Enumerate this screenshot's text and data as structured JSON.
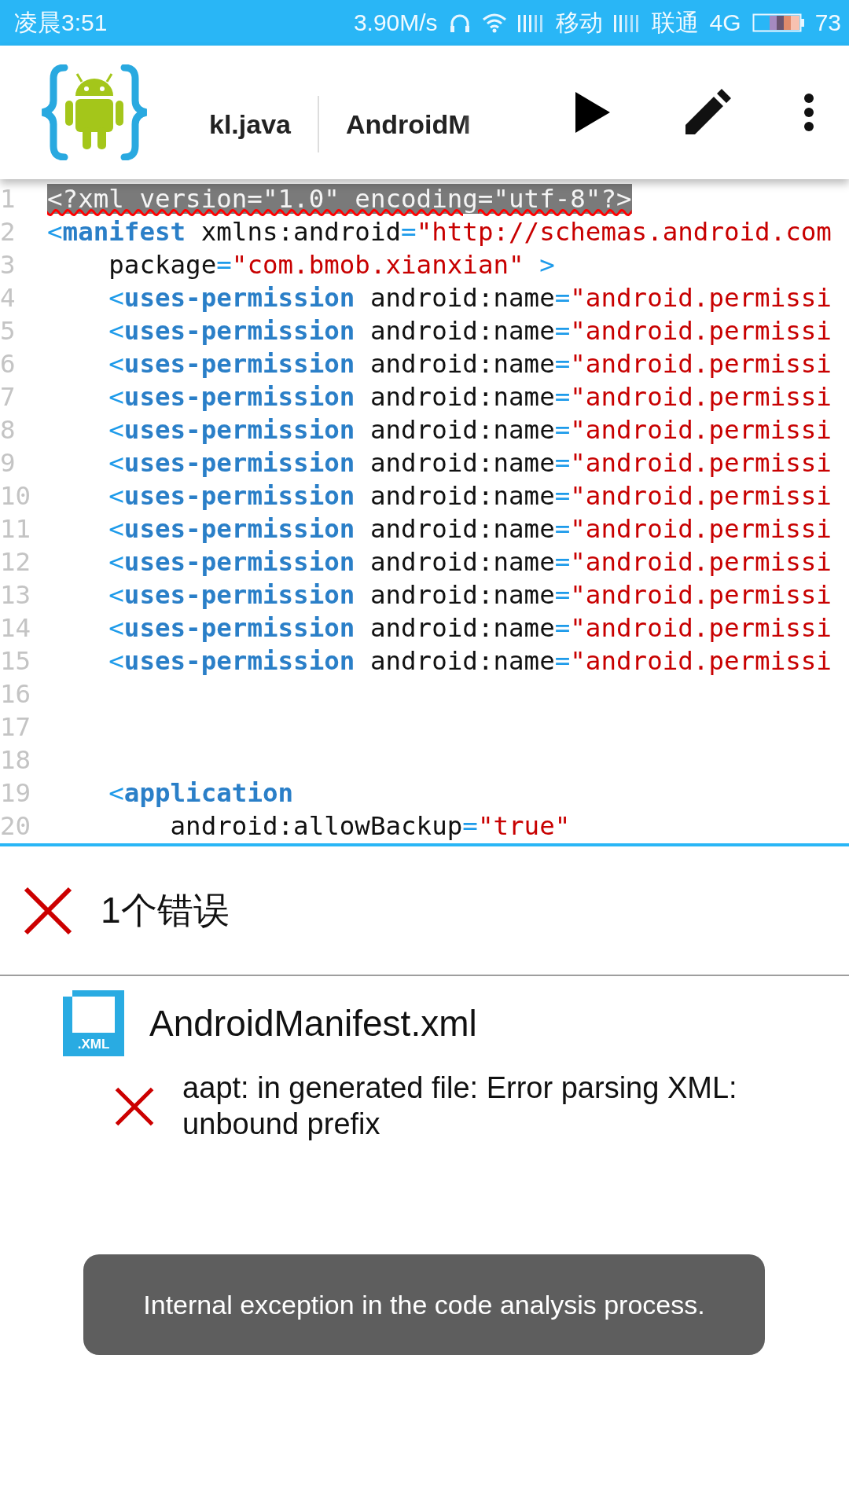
{
  "status_bar": {
    "time": "凌晨3:51",
    "speed": "3.90M/s",
    "carrier_1": "移动",
    "carrier_2": "联通",
    "network": "4G",
    "battery": "73"
  },
  "toolbar": {
    "tabs": [
      {
        "label": "kl.java"
      },
      {
        "label": "AndroidM"
      }
    ]
  },
  "code_lines": [
    {
      "number": "1",
      "segments": [
        {
          "kind": "error",
          "text": "<?xml version=\"1.0\" encoding=\"utf-8\"?>"
        }
      ]
    },
    {
      "number": "2",
      "segments": [
        {
          "kind": "punct",
          "text": "<"
        },
        {
          "kind": "tag",
          "text": "manifest"
        },
        {
          "kind": "attr",
          "text": " xmlns:android"
        },
        {
          "kind": "punct",
          "text": "="
        },
        {
          "kind": "string",
          "text": "\"http://schemas.android.com"
        }
      ]
    },
    {
      "number": "3",
      "segments": [
        {
          "kind": "attr",
          "text": "    package"
        },
        {
          "kind": "punct",
          "text": "="
        },
        {
          "kind": "string",
          "text": "\"com.bmob.xianxian\""
        },
        {
          "kind": "punct",
          "text": " >"
        }
      ]
    },
    {
      "number": "4",
      "segments": [
        {
          "kind": "punct",
          "text": "    <"
        },
        {
          "kind": "tag",
          "text": "uses-permission"
        },
        {
          "kind": "attr",
          "text": " android:name"
        },
        {
          "kind": "punct",
          "text": "="
        },
        {
          "kind": "string",
          "text": "\"android.permissi"
        }
      ]
    },
    {
      "number": "5",
      "segments": [
        {
          "kind": "punct",
          "text": "    <"
        },
        {
          "kind": "tag",
          "text": "uses-permission"
        },
        {
          "kind": "attr",
          "text": " android:name"
        },
        {
          "kind": "punct",
          "text": "="
        },
        {
          "kind": "string",
          "text": "\"android.permissi"
        }
      ]
    },
    {
      "number": "6",
      "segments": [
        {
          "kind": "punct",
          "text": "    <"
        },
        {
          "kind": "tag",
          "text": "uses-permission"
        },
        {
          "kind": "attr",
          "text": " android:name"
        },
        {
          "kind": "punct",
          "text": "="
        },
        {
          "kind": "string",
          "text": "\"android.permissi"
        }
      ]
    },
    {
      "number": "7",
      "segments": [
        {
          "kind": "punct",
          "text": "    <"
        },
        {
          "kind": "tag",
          "text": "uses-permission"
        },
        {
          "kind": "attr",
          "text": " android:name"
        },
        {
          "kind": "punct",
          "text": "="
        },
        {
          "kind": "string",
          "text": "\"android.permissi"
        }
      ]
    },
    {
      "number": "8",
      "segments": [
        {
          "kind": "punct",
          "text": "    <"
        },
        {
          "kind": "tag",
          "text": "uses-permission"
        },
        {
          "kind": "attr",
          "text": " android:name"
        },
        {
          "kind": "punct",
          "text": "="
        },
        {
          "kind": "string",
          "text": "\"android.permissi"
        }
      ]
    },
    {
      "number": "9",
      "segments": [
        {
          "kind": "punct",
          "text": "    <"
        },
        {
          "kind": "tag",
          "text": "uses-permission"
        },
        {
          "kind": "attr",
          "text": " android:name"
        },
        {
          "kind": "punct",
          "text": "="
        },
        {
          "kind": "string",
          "text": "\"android.permissi"
        }
      ]
    },
    {
      "number": "10",
      "segments": [
        {
          "kind": "punct",
          "text": "    <"
        },
        {
          "kind": "tag",
          "text": "uses-permission"
        },
        {
          "kind": "attr",
          "text": " android:name"
        },
        {
          "kind": "punct",
          "text": "="
        },
        {
          "kind": "string",
          "text": "\"android.permissi"
        }
      ]
    },
    {
      "number": "11",
      "segments": [
        {
          "kind": "punct",
          "text": "    <"
        },
        {
          "kind": "tag",
          "text": "uses-permission"
        },
        {
          "kind": "attr",
          "text": " android:name"
        },
        {
          "kind": "punct",
          "text": "="
        },
        {
          "kind": "string",
          "text": "\"android.permissi"
        }
      ]
    },
    {
      "number": "12",
      "segments": [
        {
          "kind": "punct",
          "text": "    <"
        },
        {
          "kind": "tag",
          "text": "uses-permission"
        },
        {
          "kind": "attr",
          "text": " android:name"
        },
        {
          "kind": "punct",
          "text": "="
        },
        {
          "kind": "string",
          "text": "\"android.permissi"
        }
      ]
    },
    {
      "number": "13",
      "segments": [
        {
          "kind": "punct",
          "text": "    <"
        },
        {
          "kind": "tag",
          "text": "uses-permission"
        },
        {
          "kind": "attr",
          "text": " android:name"
        },
        {
          "kind": "punct",
          "text": "="
        },
        {
          "kind": "string",
          "text": "\"android.permissi"
        }
      ]
    },
    {
      "number": "14",
      "segments": [
        {
          "kind": "punct",
          "text": "    <"
        },
        {
          "kind": "tag",
          "text": "uses-permission"
        },
        {
          "kind": "attr",
          "text": " android:name"
        },
        {
          "kind": "punct",
          "text": "="
        },
        {
          "kind": "string",
          "text": "\"android.permissi"
        }
      ]
    },
    {
      "number": "15",
      "segments": [
        {
          "kind": "punct",
          "text": "    <"
        },
        {
          "kind": "tag",
          "text": "uses-permission"
        },
        {
          "kind": "attr",
          "text": " android:name"
        },
        {
          "kind": "punct",
          "text": "="
        },
        {
          "kind": "string",
          "text": "\"android.permissi"
        }
      ]
    },
    {
      "number": "16"
    },
    {
      "number": "17"
    },
    {
      "number": "18"
    },
    {
      "number": "19",
      "segments": [
        {
          "kind": "punct",
          "text": "    <"
        },
        {
          "kind": "tag",
          "text": "application"
        }
      ]
    },
    {
      "number": "20",
      "segments": [
        {
          "kind": "attr",
          "text": "        android:allowBackup"
        },
        {
          "kind": "punct",
          "text": "="
        },
        {
          "kind": "string",
          "text": "\"true\""
        }
      ]
    }
  ],
  "errors": {
    "summary": "1个错误",
    "files": [
      {
        "name": "AndroidManifest.xml",
        "icon_label": ".XML",
        "messages": [
          "aapt: in generated file: Error parsing XML: unbound prefix"
        ]
      }
    ]
  },
  "toast": "Internal exception in the code analysis process."
}
